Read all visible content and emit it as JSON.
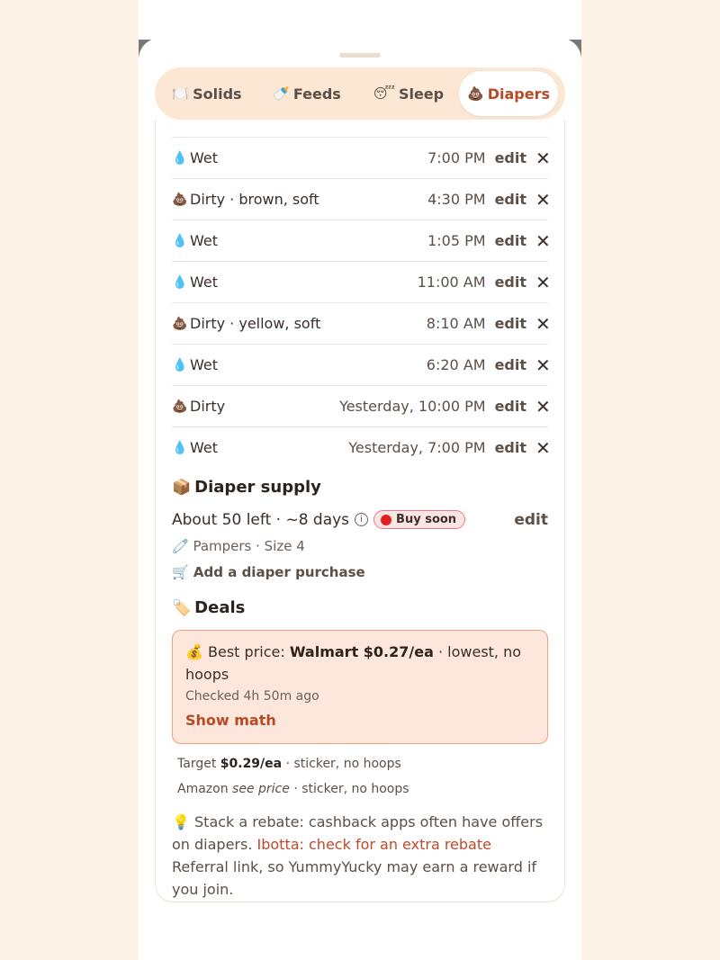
{
  "tabs": [
    {
      "emoji": "🍽️",
      "label": "Solids",
      "active": false
    },
    {
      "emoji": "🍼",
      "label": "Feeds",
      "active": false
    },
    {
      "emoji": "😴",
      "label": "Sleep",
      "active": false
    },
    {
      "emoji": "💩",
      "label": "Diapers",
      "active": true
    }
  ],
  "log": [
    {
      "emoji": "💧",
      "desc": "Wet",
      "time": "7:00 PM"
    },
    {
      "emoji": "💩",
      "desc": "Dirty · brown, soft",
      "time": "4:30 PM"
    },
    {
      "emoji": "💧",
      "desc": "Wet",
      "time": "1:05 PM"
    },
    {
      "emoji": "💧",
      "desc": "Wet",
      "time": "11:00 AM"
    },
    {
      "emoji": "💩",
      "desc": "Dirty · yellow, soft",
      "time": "8:10 AM"
    },
    {
      "emoji": "💧",
      "desc": "Wet",
      "time": "6:20 AM"
    },
    {
      "emoji": "💩",
      "desc": "Dirty",
      "time": "Yesterday, 10:00 PM"
    },
    {
      "emoji": "💧",
      "desc": "Wet",
      "time": "Yesterday, 7:00 PM"
    }
  ],
  "row_edit_label": "edit",
  "row_delete_glyph": "✕",
  "supply": {
    "emoji": "📦",
    "title": "Diaper supply",
    "count_text": "About 50 left · ~8 days",
    "info_glyph": "i",
    "badge_label": "Buy soon",
    "edit_label": "edit",
    "brand_emoji": "🧷",
    "brand_text": "Pampers · Size 4",
    "add_emoji": "🛒",
    "add_label": "Add a diaper purchase"
  },
  "deals": {
    "emoji": "🏷️",
    "title": "Deals",
    "best_emoji": "💰",
    "best_prefix": "Best price:",
    "best_store_price": "Walmart $0.27/ea",
    "best_suffix": "· lowest, no hoops",
    "checked": "Checked 4h 50m ago",
    "show_math": "Show math",
    "alternatives": [
      {
        "store": "Target",
        "price": "$0.29/ea",
        "note": "· sticker, no hoops"
      },
      {
        "store": "Amazon",
        "price": "see price",
        "note": "· sticker, no hoops"
      }
    ]
  },
  "rebate": {
    "emoji": "💡",
    "text_before": "Stack a rebate: cashback apps often have offers on diapers.",
    "link": "Ibotta: check for an extra rebate",
    "text_after": "Referral link, so YummyYucky may earn a reward if you join."
  },
  "colors": {
    "accent": "#b54a25",
    "page_bg": "#fdf3e6",
    "tab_bg": "#fbe7d3",
    "deal_bg": "#fde7dc",
    "badge_red": "#e02020"
  }
}
